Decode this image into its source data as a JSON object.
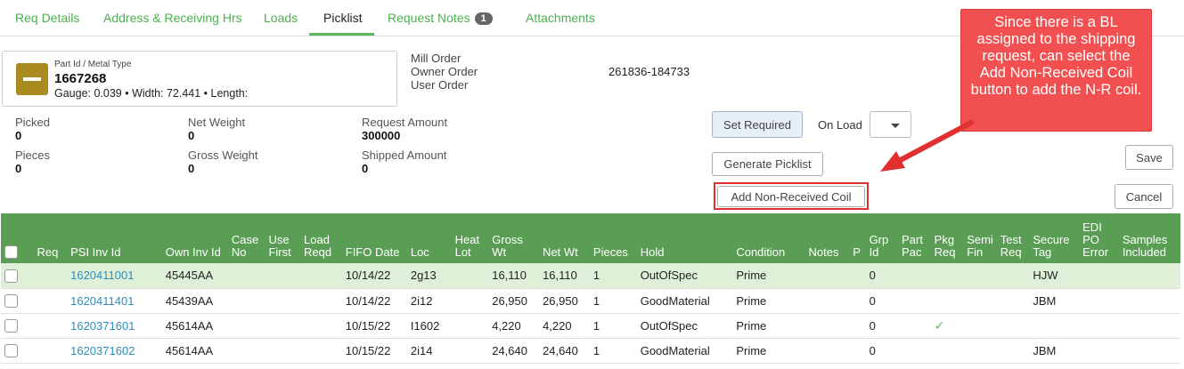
{
  "tabs": [
    {
      "label": "Req Details"
    },
    {
      "label": "Address & Receiving Hrs"
    },
    {
      "label": "Loads"
    },
    {
      "label": "Picklist"
    },
    {
      "label": "Request Notes",
      "badge": "1"
    },
    {
      "label": "Attachments"
    }
  ],
  "part": {
    "caption": "Part Id / Metal Type",
    "id": "1667268",
    "specs": "Gauge: 0.039 • Width: 72.441 • Length:",
    "icon": "minus-icon"
  },
  "orders": {
    "mill_label": "Mill Order",
    "owner_label": "Owner Order",
    "user_label": "User Order",
    "owner_value": "261836-184733"
  },
  "stats": {
    "picked": {
      "label": "Picked",
      "value": "0"
    },
    "net_weight": {
      "label": "Net Weight",
      "value": "0"
    },
    "request_amount": {
      "label": "Request Amount",
      "value": "300000"
    },
    "pieces": {
      "label": "Pieces",
      "value": "0"
    },
    "gross_weight": {
      "label": "Gross Weight",
      "value": "0"
    },
    "shipped_amount": {
      "label": "Shipped Amount",
      "value": "0"
    }
  },
  "actions": {
    "set_required": "Set Required",
    "on_load_label": "On Load",
    "generate_picklist": "Generate Picklist",
    "add_non_received": "Add Non-Received Coil",
    "save": "Save",
    "cancel": "Cancel"
  },
  "callout": {
    "text": "Since there is a BL assigned to the shipping request, can select the Add Non-Received Coil button to add the N-R coil."
  },
  "table": {
    "headers": {
      "req": "Req",
      "psi_inv_id": "PSI Inv Id",
      "own_inv_id": "Own Inv Id",
      "case_no": "Case No",
      "use_first": "Use First",
      "load_reqd": "Load Reqd",
      "fifo_date": "FIFO Date",
      "loc": "Loc",
      "heat_lot": "Heat Lot",
      "gross_wt": "Gross Wt",
      "net_wt": "Net Wt",
      "pieces": "Pieces",
      "hold": "Hold",
      "condition": "Condition",
      "notes": "Notes",
      "p": "P",
      "grp_id": "Grp Id",
      "part_pac": "Part Pac",
      "pkg_req": "Pkg Req",
      "semi_fin": "Semi Fin",
      "test_req": "Test Req",
      "secure_tag": "Secure Tag",
      "edi_po_error": "EDI PO Error",
      "samples_included": "Samples Included"
    },
    "rows": [
      {
        "psi": "1620411001",
        "own": "45445AA",
        "fifo": "10/14/22",
        "loc": "2g13",
        "gross": "16,110",
        "net": "16,110",
        "pieces": "1",
        "hold": "OutOfSpec",
        "condition": "Prime",
        "grp": "0",
        "secure": "HJW"
      },
      {
        "psi": "1620411401",
        "own": "45439AA",
        "fifo": "10/14/22",
        "loc": "2i12",
        "gross": "26,950",
        "net": "26,950",
        "pieces": "1",
        "hold": "GoodMaterial",
        "condition": "Prime",
        "grp": "0",
        "secure": "JBM"
      },
      {
        "psi": "1620371601",
        "own": "45614AA",
        "fifo": "10/15/22",
        "loc": "I1602",
        "gross": "4,220",
        "net": "4,220",
        "pieces": "1",
        "hold": "OutOfSpec",
        "condition": "Prime",
        "grp": "0",
        "secure": ""
      },
      {
        "psi": "1620371602",
        "own": "45614AA",
        "fifo": "10/15/22",
        "loc": "2i14",
        "gross": "24,640",
        "net": "24,640",
        "pieces": "1",
        "hold": "GoodMaterial",
        "condition": "Prime",
        "grp": "0",
        "secure": "JBM"
      }
    ]
  }
}
